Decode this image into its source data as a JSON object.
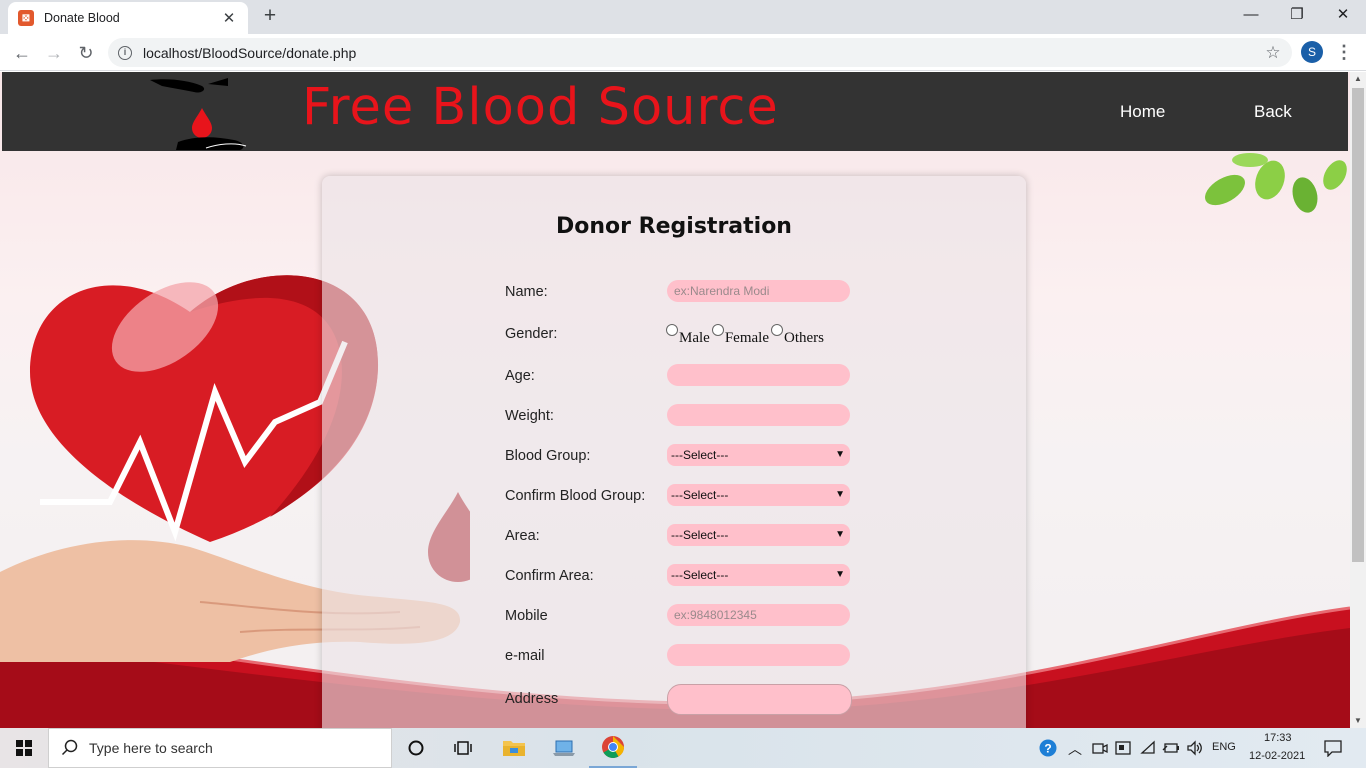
{
  "browser": {
    "tab_title": "Donate Blood",
    "url": "localhost/BloodSource/donate.php",
    "profile_initial": "S"
  },
  "header": {
    "site_title": "Free Blood Source",
    "nav": [
      "Home",
      "Back"
    ]
  },
  "form": {
    "title": "Donor Registration",
    "labels": {
      "name": "Name:",
      "gender": "Gender:",
      "age": "Age:",
      "weight": "Weight:",
      "blood_group": "Blood Group:",
      "confirm_blood_group": "Confirm Blood Group:",
      "area": "Area:",
      "confirm_area": "Confirm Area:",
      "mobile": "Mobile",
      "email": "e-mail",
      "address": "Address"
    },
    "placeholders": {
      "name": "ex:Narendra Modi",
      "mobile": "ex:9848012345"
    },
    "gender_options": [
      "Male",
      "Female",
      "Others"
    ],
    "selects": {
      "blood_group": "---Select---",
      "confirm_blood_group": "---Select---",
      "area": "---Select---",
      "confirm_area": "---Select---"
    }
  },
  "taskbar": {
    "search_placeholder": "Type here to search",
    "language": "ENG",
    "time": "17:33",
    "date": "12-02-2021"
  },
  "colors": {
    "header_bg": "#333333",
    "title_red": "#e8141b",
    "field_pink": "#ffc0cb"
  }
}
